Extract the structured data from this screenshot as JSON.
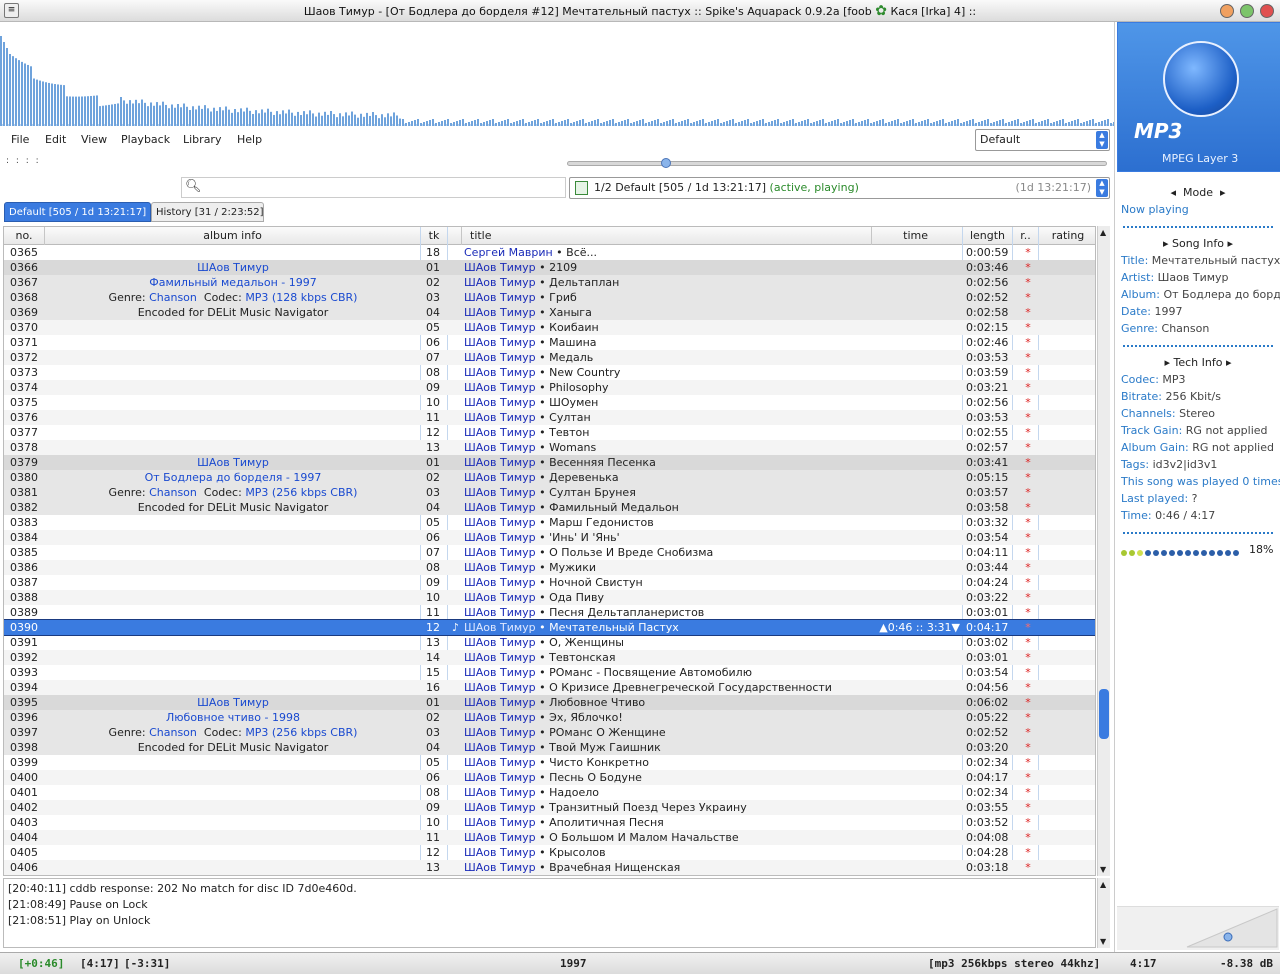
{
  "window": {
    "title": "Шаов Тимур - [От Бодлера до борделя #12] Мечтательный пастух   ::  Spike's Aquapack 0.9.2a [foob",
    "title_tail": "Кася [Irka] 4] ::",
    "sysmenu": "≡"
  },
  "menu": {
    "items": [
      "File",
      "Edit",
      "View",
      "Playback",
      "Library",
      "Help"
    ],
    "preset": "Default"
  },
  "toolbar": {
    "dots": ": : : :"
  },
  "playlist_selector": {
    "text": "1/2 Default [505 / 1d 13:21:17]",
    "status": "(active, playing)",
    "duration": "(1d 13:21:17)"
  },
  "tabs": [
    {
      "label": "Default [505 / 1d 13:21:17]"
    },
    {
      "label": "History [31 / 2:23:52]"
    }
  ],
  "columns": {
    "no": "no.",
    "album": "album info",
    "tk": "tk",
    "title": "title",
    "time": "time",
    "length": "length",
    "r": "r..",
    "rating": "rating"
  },
  "rows": [
    {
      "no": "0365",
      "album": "",
      "tk": "18",
      "artist": "Сергей Маврин",
      "song": "Всё...",
      "len": "0:00:59",
      "grp": ""
    },
    {
      "no": "0366",
      "album": "ШАов Тимур",
      "tk": "01",
      "artist": "ШАов Тимур",
      "song": "2109",
      "len": "0:03:46",
      "grp": "h"
    },
    {
      "no": "0367",
      "album": "Фамильный медальон - 1997",
      "tk": "02",
      "artist": "ШАов Тимур",
      "song": "Дельтаплан",
      "len": "0:02:56",
      "grp": "g"
    },
    {
      "no": "0368",
      "album": "",
      "albumGenre": "Chanson",
      "albumCodec": "MP3 (128 kbps CBR)",
      "tk": "03",
      "artist": "ШАов Тимур",
      "song": "Гриб",
      "len": "0:02:52",
      "grp": "g"
    },
    {
      "no": "0369",
      "album": "Encoded for DELit Music Navigator",
      "tk": "04",
      "artist": "ШАов Тимур",
      "song": "Ханыга",
      "len": "0:02:58",
      "grp": "g"
    },
    {
      "no": "0370",
      "album": "",
      "tk": "05",
      "artist": "ШАов Тимур",
      "song": "Коибаин",
      "len": "0:02:15",
      "grp": ""
    },
    {
      "no": "0371",
      "album": "",
      "tk": "06",
      "artist": "ШАов Тимур",
      "song": "Машина",
      "len": "0:02:46",
      "grp": ""
    },
    {
      "no": "0372",
      "album": "",
      "tk": "07",
      "artist": "ШАов Тимур",
      "song": "Медаль",
      "len": "0:03:53",
      "grp": ""
    },
    {
      "no": "0373",
      "album": "",
      "tk": "08",
      "artist": "ШАов Тимур",
      "song": "New Country",
      "len": "0:03:59",
      "grp": ""
    },
    {
      "no": "0374",
      "album": "",
      "tk": "09",
      "artist": "ШАов Тимур",
      "song": "Philosophy",
      "len": "0:03:21",
      "grp": ""
    },
    {
      "no": "0375",
      "album": "",
      "tk": "10",
      "artist": "ШАов Тимур",
      "song": "ШОумен",
      "len": "0:02:56",
      "grp": ""
    },
    {
      "no": "0376",
      "album": "",
      "tk": "11",
      "artist": "ШАов Тимур",
      "song": "Султан",
      "len": "0:03:53",
      "grp": ""
    },
    {
      "no": "0377",
      "album": "",
      "tk": "12",
      "artist": "ШАов Тимур",
      "song": "Тевтон",
      "len": "0:02:55",
      "grp": ""
    },
    {
      "no": "0378",
      "album": "",
      "tk": "13",
      "artist": "ШАов Тимур",
      "song": "Womans",
      "len": "0:02:57",
      "grp": ""
    },
    {
      "no": "0379",
      "album": "ШАов Тимур",
      "tk": "01",
      "artist": "ШАов Тимур",
      "song": "Весенняя Песенка",
      "len": "0:03:41",
      "grp": "h"
    },
    {
      "no": "0380",
      "album": "От Бодлера до борделя - 1997",
      "tk": "02",
      "artist": "ШАов Тимур",
      "song": "Деревенька",
      "len": "0:05:15",
      "grp": "g"
    },
    {
      "no": "0381",
      "album": "",
      "albumGenre": "Chanson",
      "albumCodec": "MP3 (256 kbps CBR)",
      "tk": "03",
      "artist": "ШАов Тимур",
      "song": "Султан Брунея",
      "len": "0:03:57",
      "grp": "g"
    },
    {
      "no": "0382",
      "album": "Encoded for DELit Music Navigator",
      "tk": "04",
      "artist": "ШАов Тимур",
      "song": "Фамильный Медальон",
      "len": "0:03:58",
      "grp": "g"
    },
    {
      "no": "0383",
      "album": "",
      "tk": "05",
      "artist": "ШАов Тимур",
      "song": "Марш Гедонистов",
      "len": "0:03:32",
      "grp": ""
    },
    {
      "no": "0384",
      "album": "",
      "tk": "06",
      "artist": "ШАов Тимур",
      "song": "'Инь' И 'Янь'",
      "len": "0:03:54",
      "grp": ""
    },
    {
      "no": "0385",
      "album": "",
      "tk": "07",
      "artist": "ШАов Тимур",
      "song": "О Пользе И Вреде Снобизма",
      "len": "0:04:11",
      "grp": ""
    },
    {
      "no": "0386",
      "album": "",
      "tk": "08",
      "artist": "ШАов Тимур",
      "song": "Мужики",
      "len": "0:03:44",
      "grp": ""
    },
    {
      "no": "0387",
      "album": "",
      "tk": "09",
      "artist": "ШАов Тимур",
      "song": "Ночной Свистун",
      "len": "0:04:24",
      "grp": ""
    },
    {
      "no": "0388",
      "album": "",
      "tk": "10",
      "artist": "ШАов Тимур",
      "song": "Ода Пиву",
      "len": "0:03:22",
      "grp": ""
    },
    {
      "no": "0389",
      "album": "",
      "tk": "11",
      "artist": "ШАов Тимур",
      "song": "Песня Дельтапланеристов",
      "len": "0:03:01",
      "grp": ""
    },
    {
      "no": "0390",
      "album": "",
      "tk": "12",
      "artist": "ШАов Тимур",
      "song": "Мечтательный Пастух",
      "len": "0:04:17",
      "grp": "sel",
      "time": "▲0:46  ::  3:31▼",
      "playing": "♪"
    },
    {
      "no": "0391",
      "album": "",
      "tk": "13",
      "artist": "ШАов Тимур",
      "song": "О, Женщины",
      "len": "0:03:02",
      "grp": ""
    },
    {
      "no": "0392",
      "album": "",
      "tk": "14",
      "artist": "ШАов Тимур",
      "song": "Тевтонская",
      "len": "0:03:01",
      "grp": ""
    },
    {
      "no": "0393",
      "album": "",
      "tk": "15",
      "artist": "ШАов Тимур",
      "song": "РОманс - Посвящение Автомобилю",
      "len": "0:03:54",
      "grp": ""
    },
    {
      "no": "0394",
      "album": "",
      "tk": "16",
      "artist": "ШАов Тимур",
      "song": "О Кризисе Древнегреческой Государственности",
      "len": "0:04:56",
      "grp": ""
    },
    {
      "no": "0395",
      "album": "ШАов Тимур",
      "tk": "01",
      "artist": "ШАов Тимур",
      "song": "Любовное Чтиво",
      "len": "0:06:02",
      "grp": "h"
    },
    {
      "no": "0396",
      "album": "Любовное чтиво - 1998",
      "tk": "02",
      "artist": "ШАов Тимур",
      "song": "Эх, Яблочко!",
      "len": "0:05:22",
      "grp": "g"
    },
    {
      "no": "0397",
      "album": "",
      "albumGenre": "Chanson",
      "albumCodec": "MP3 (256 kbps CBR)",
      "tk": "03",
      "artist": "ШАов Тимур",
      "song": "РОманс О Женщине",
      "len": "0:02:52",
      "grp": "g"
    },
    {
      "no": "0398",
      "album": "Encoded for DELit Music Navigator",
      "tk": "04",
      "artist": "ШАов Тимур",
      "song": "Твой Муж Гаишник",
      "len": "0:03:20",
      "grp": "g"
    },
    {
      "no": "0399",
      "album": "",
      "tk": "05",
      "artist": "ШАов Тимур",
      "song": "Чисто Конкретно",
      "len": "0:02:34",
      "grp": ""
    },
    {
      "no": "0400",
      "album": "",
      "tk": "06",
      "artist": "ШАов Тимур",
      "song": "Песнь О Бодуне",
      "len": "0:04:17",
      "grp": ""
    },
    {
      "no": "0401",
      "album": "",
      "tk": "08",
      "artist": "ШАов Тимур",
      "song": "Надоело",
      "len": "0:02:34",
      "grp": ""
    },
    {
      "no": "0402",
      "album": "",
      "tk": "09",
      "artist": "ШАов Тимур",
      "song": "Транзитный Поезд Через Украину",
      "len": "0:03:55",
      "grp": ""
    },
    {
      "no": "0403",
      "album": "",
      "tk": "10",
      "artist": "ШАов Тимур",
      "song": "Аполитичная Песня",
      "len": "0:03:52",
      "grp": ""
    },
    {
      "no": "0404",
      "album": "",
      "tk": "11",
      "artist": "ШАов Тимур",
      "song": "О Большом И Малом Начальстве",
      "len": "0:04:08",
      "grp": ""
    },
    {
      "no": "0405",
      "album": "",
      "tk": "12",
      "artist": "ШАов Тимур",
      "song": "Крысолов",
      "len": "0:04:28",
      "grp": ""
    },
    {
      "no": "0406",
      "album": "",
      "tk": "13",
      "artist": "ШАов Тимур",
      "song": "Врачебная Нищенская",
      "len": "0:03:18",
      "grp": ""
    }
  ],
  "labels": {
    "genre": "Genre:",
    "codec": "Codec:",
    "sep": " • ",
    "rating_mark": "*"
  },
  "console": [
    "[20:40:11] cddb response: 202 No match for disc ID 7d0e460d.",
    "[21:08:49] Pause on Lock",
    "[21:08:51] Play on Unlock"
  ],
  "status": {
    "elapsed": "[+0:46]",
    "total": "[4:17]",
    "remaining": "[-3:31]",
    "year": "1997",
    "format": "[mp3 256kbps stereo 44khz]",
    "length": "4:17",
    "gain": "-8.38 dB"
  },
  "side": {
    "art_mp3": "MP3",
    "art_layer": "MPEG Layer 3",
    "mode": "Mode",
    "now_playing": "Now playing",
    "song_info": "Song Info",
    "song": [
      [
        "Title:",
        "Мечтательный пастух"
      ],
      [
        "Artist:",
        "Шаов Тимур"
      ],
      [
        "Album:",
        "От Бодлера до борделя"
      ],
      [
        "Date:",
        "1997"
      ],
      [
        "Genre:",
        "Chanson"
      ]
    ],
    "tech_info": "Tech Info",
    "tech": [
      [
        "Codec:",
        "MP3"
      ],
      [
        "Bitrate:",
        "256 Kbit/s"
      ],
      [
        "Channels:",
        "Stereo"
      ],
      [
        "Track Gain:",
        "RG not applied"
      ],
      [
        "Album Gain:",
        "RG not applied"
      ],
      [
        "Tags:",
        "id3v2|id3v1"
      ]
    ],
    "played_pre": "This song was played",
    "played_count": "0",
    "played_post": "times",
    "last_played_label": "Last played:",
    "last_played": "?",
    "time_label": "Time:",
    "time_value": "0:46 / 4:17",
    "progress_text": "18%",
    "progress_fraction": 0.18
  },
  "colors": {
    "accent": "#3a7be0",
    "link": "#2a7ac8",
    "artist": "#1a2bb8",
    "rating": "#dd2222"
  }
}
